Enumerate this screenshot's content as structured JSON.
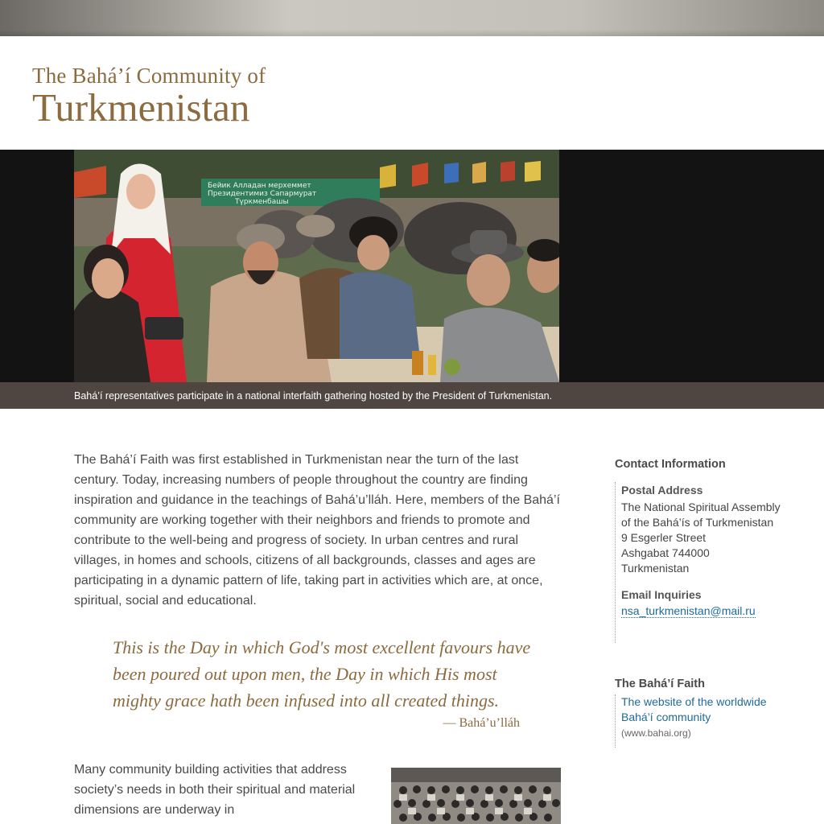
{
  "header": {
    "title_line1": "The Bahá’í Community of",
    "title_line2": "Turkmenistan"
  },
  "hero": {
    "banner_text_1": "Бейик Алладан мерхеммет",
    "banner_text_2": "Президентимиз Сапармурат",
    "banner_text_3": "Түркменбашы",
    "caption": "Bahá’í representatives participate in a national interfaith gathering hosted by the President of Turkmenistan."
  },
  "main": {
    "intro": "The Bahá’í Faith was first established in Turkmenistan near the turn of the last century. Today, increasing numbers of people throughout the country are finding inspiration and guidance in the teachings of Bahá’u’lláh. Here, members of the Bahá’í community are working together with their neighbors and friends to promote and contribute to the well-being and progress of society. In urban centres and rural villages, in homes and schools, citizens of all backgrounds, classes and ages are participating in a dynamic pattern of life, taking part in activities which are, at once, spiritual, social and educational.",
    "quote": "This is the Day in which God's most excellent favours have been poured out upon men, the Day in which His most mighty grace hath been infused into all created things.",
    "quote_attribution": "— Bahá’u’lláh",
    "para2": "Many community building activities that address society’s needs in both their spiritual and material dimensions are underway in"
  },
  "sidebar": {
    "contact_heading": "Contact Information",
    "postal_label": "Postal Address",
    "address_lines": [
      "The National Spiritual Assembly",
      "of the Bahá’ís of Turkmenistan",
      "9 Esgerler Street",
      "Ashgabat 744000",
      "Turkmenistan"
    ],
    "email_label": "Email Inquiries",
    "email": "nsa_turkmenistan@mail.ru",
    "faith_heading": "The Bahá’í Faith",
    "faith_link_line1": "The website of the worldwide",
    "faith_link_line2": "Bahá’í community",
    "faith_url": "(www.bahai.org)"
  },
  "colors": {
    "brand_gold": "#8b6b3f",
    "link_blue": "#1f6a9a",
    "caption_bar": "#4f4641",
    "hero_bg": "#141313"
  }
}
